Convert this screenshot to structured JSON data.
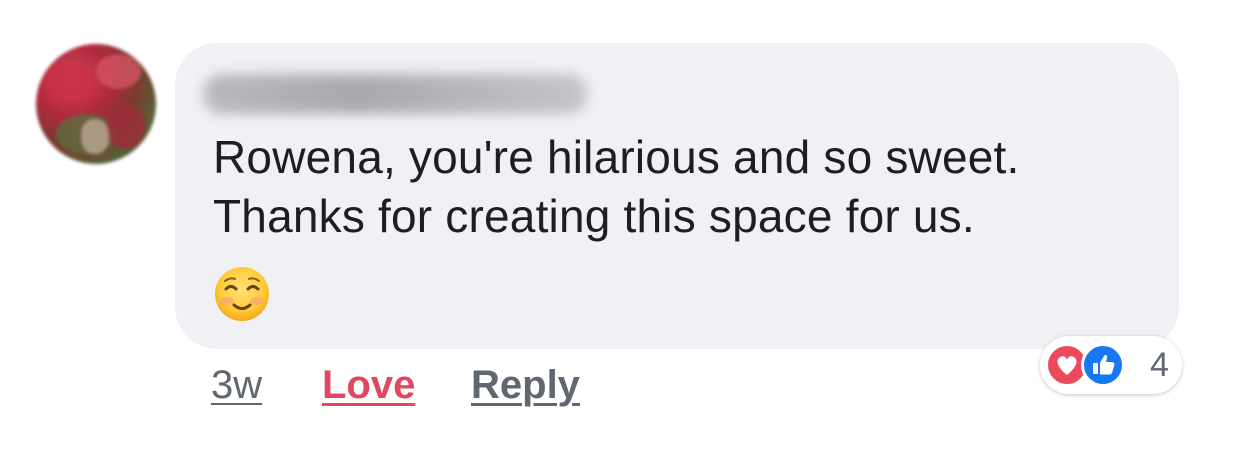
{
  "comment": {
    "author_name": "",
    "text_lines": [
      "Rowena, you're hilarious and so sweet.",
      "Thanks for creating this space for us."
    ],
    "emoji": "☺️",
    "emoji_name": "smiling-face-icon"
  },
  "actions": {
    "timestamp": "3w",
    "love_label": "Love",
    "reply_label": "Reply"
  },
  "reactions": {
    "icons": [
      "heart-icon",
      "thumbs-up-icon"
    ],
    "count": "4"
  },
  "colors": {
    "bubble_bg": "#f0f1f5",
    "love": "#e0485f",
    "like": "#1877f2",
    "heart": "#ec4a5c",
    "secondary_text": "#616770"
  }
}
